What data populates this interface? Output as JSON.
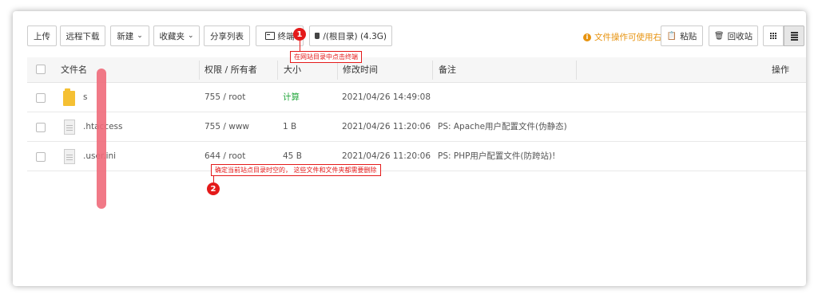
{
  "toolbar": {
    "upload": "上传",
    "remote_download": "远程下载",
    "new": "新建",
    "favorites": "收藏夹",
    "share_list": "分享列表",
    "terminal": "终端",
    "path": "/(根目录) (4.3G)",
    "tip": "文件操作可使用右键",
    "paste": "粘贴",
    "recycle_bin": "回收站"
  },
  "table": {
    "headers": {
      "name": "文件名",
      "perm": "权限 / 所有者",
      "size": "大小",
      "mtime": "修改时间",
      "note": "备注",
      "ops": "操作"
    },
    "rows": [
      {
        "name": "s",
        "type": "folder",
        "perm": "755 / root",
        "size": "计算",
        "mtime": "2021/04/26 14:49:08",
        "note": ""
      },
      {
        "name": ".htaccess",
        "type": "file",
        "perm": "755 / www",
        "size": "1 B",
        "mtime": "2021/04/26 11:20:06",
        "note": "PS: Apache用户配置文件(伪静态)"
      },
      {
        "name": ".user.ini",
        "type": "file",
        "perm": "644 / root",
        "size": "45 B",
        "mtime": "2021/04/26 11:20:06",
        "note": "PS: PHP用户配置文件(防跨站)!"
      }
    ]
  },
  "annotations": {
    "badge1": "1",
    "callout1": "在网站目录中点击终端",
    "badge2": "2",
    "callout2": "确定当前站点目录时空的，  这些文件和文件夹都需要删除"
  },
  "colors": {
    "accent_green": "#20a53a",
    "annotation_red": "#e41a1a",
    "tip_orange": "#e7930f"
  }
}
